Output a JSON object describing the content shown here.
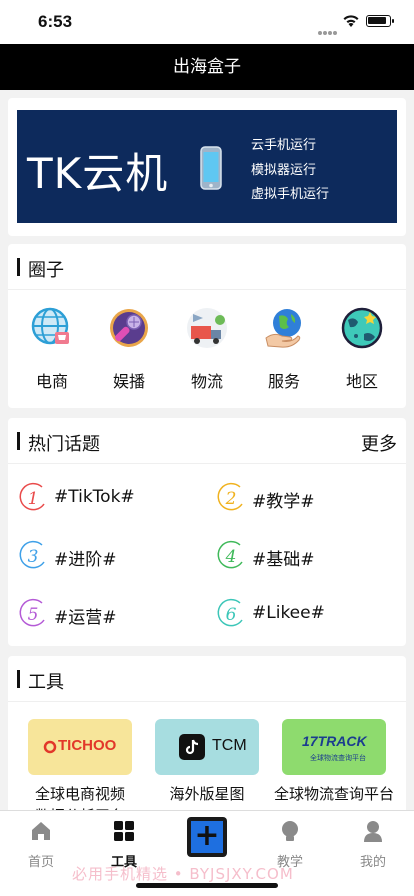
{
  "status": {
    "time": "6:53"
  },
  "navbar": {
    "title": "出海盒子"
  },
  "banner": {
    "title": "TK云机",
    "lines": [
      "云手机运行",
      "模拟器运行",
      "虚拟手机运行"
    ],
    "bg_color": "#0d2a5c"
  },
  "circle": {
    "title": "圈子",
    "items": [
      {
        "label": "电商",
        "icon": "globe-shop-icon"
      },
      {
        "label": "娱播",
        "icon": "microphone-icon"
      },
      {
        "label": "物流",
        "icon": "delivery-truck-icon"
      },
      {
        "label": "服务",
        "icon": "hand-globe-icon"
      },
      {
        "label": "地区",
        "icon": "planet-icon"
      }
    ]
  },
  "topics": {
    "title": "热门话题",
    "more": "更多",
    "items": [
      {
        "num": "1",
        "label": "#TikTok#",
        "color": "#e94b4b"
      },
      {
        "num": "2",
        "label": "#教学#",
        "color": "#f0b21f"
      },
      {
        "num": "3",
        "label": "#进阶#",
        "color": "#3ea0e8"
      },
      {
        "num": "4",
        "label": "#基础#",
        "color": "#3fb95a"
      },
      {
        "num": "5",
        "label": "#运营#",
        "color": "#b45ad6"
      },
      {
        "num": "6",
        "label": "#Likee#",
        "color": "#3cc6b8"
      }
    ]
  },
  "tools": {
    "title": "工具",
    "items": [
      {
        "logo": "TICHOO",
        "name_line1": "全球电商视频",
        "name_line2": "数据分析平台",
        "bg": "#f7e59a"
      },
      {
        "logo": "TCM",
        "name_line1": "海外版星图",
        "name_line2": "",
        "bg": "#a7dde0"
      },
      {
        "logo": "17TRACK",
        "logo_sub": "全球物流查询平台",
        "name_line1": "全球物流查询平台",
        "name_line2": "",
        "bg": "#8edb6e"
      }
    ]
  },
  "tabbar": {
    "items": [
      {
        "label": "首页",
        "icon": "home-icon"
      },
      {
        "label": "工具",
        "icon": "grid-icon",
        "active": true
      },
      {
        "label": "",
        "icon": "plus-icon"
      },
      {
        "label": "教学",
        "icon": "bulb-icon"
      },
      {
        "label": "我的",
        "icon": "person-icon"
      }
    ],
    "watermark": "必用手机精选 • BYJSJXY.COM"
  }
}
